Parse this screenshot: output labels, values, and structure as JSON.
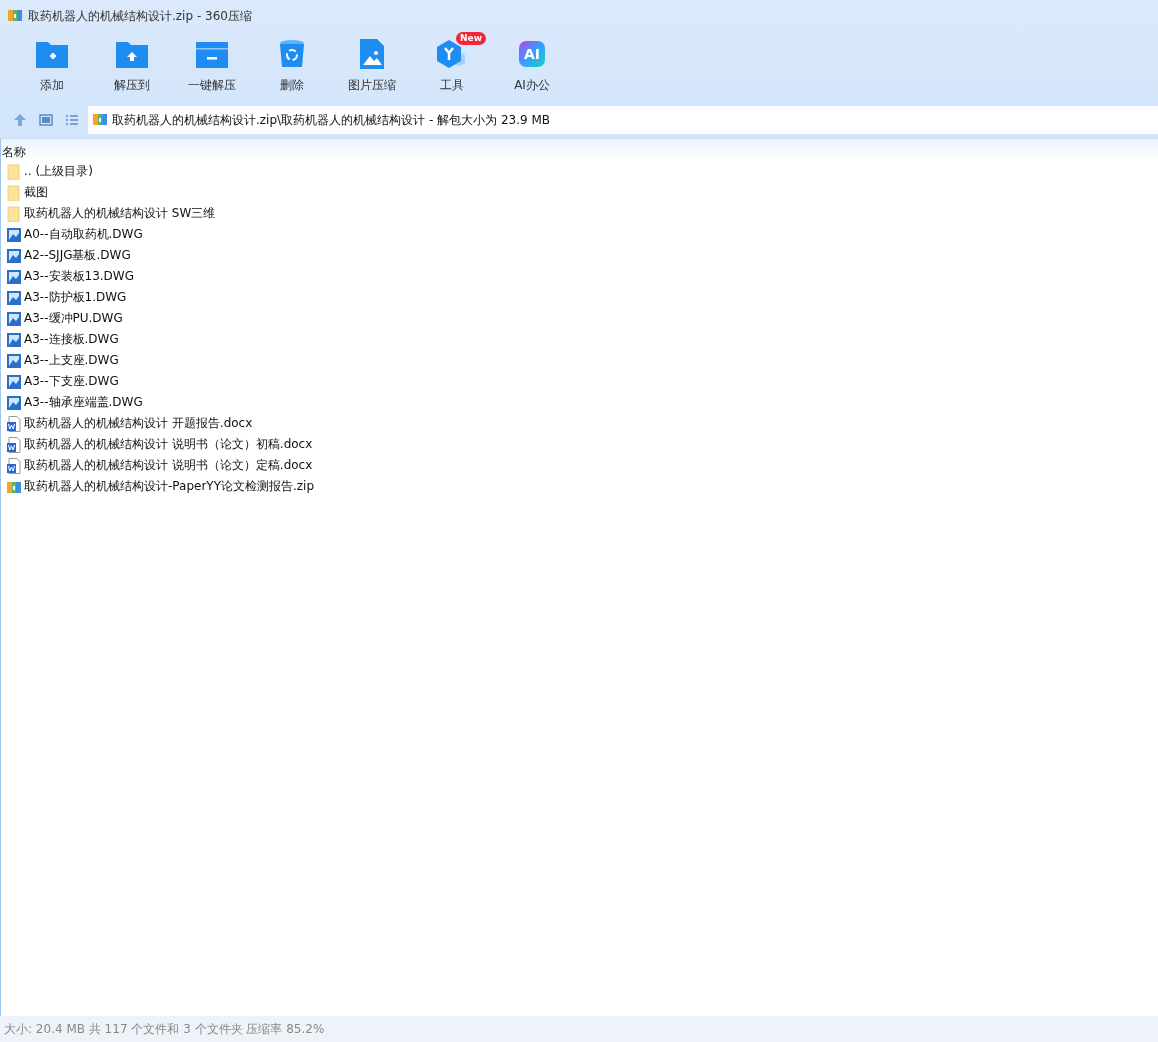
{
  "window": {
    "title": "取药机器人的机械结构设计.zip - 360压缩"
  },
  "toolbar": [
    {
      "kind": "add",
      "label": "添加"
    },
    {
      "kind": "extract",
      "label": "解压到"
    },
    {
      "kind": "quick",
      "label": "一键解压"
    },
    {
      "kind": "delete",
      "label": "删除"
    },
    {
      "kind": "image",
      "label": "图片压缩"
    },
    {
      "kind": "tools",
      "label": "工具",
      "badge": "New"
    },
    {
      "kind": "ai",
      "label": "AI办公",
      "icon_text": "AI"
    }
  ],
  "address": {
    "path": "取药机器人的机械结构设计.zip\\取药机器人的机械结构设计 - 解包大小为 23.9 MB"
  },
  "file_list": {
    "columns": [
      "名称"
    ],
    "rows": [
      {
        "kind": "folder",
        "name": ".. (上级目录)"
      },
      {
        "kind": "folder",
        "name": "截图"
      },
      {
        "kind": "folder",
        "name": "取药机器人的机械结构设计 SW三维"
      },
      {
        "kind": "dwg",
        "name": "A0--自动取药机.DWG"
      },
      {
        "kind": "dwg",
        "name": "A2--SJJG基板.DWG"
      },
      {
        "kind": "dwg",
        "name": "A3--安装板13.DWG"
      },
      {
        "kind": "dwg",
        "name": "A3--防护板1.DWG"
      },
      {
        "kind": "dwg",
        "name": "A3--缓冲PU.DWG"
      },
      {
        "kind": "dwg",
        "name": "A3--连接板.DWG"
      },
      {
        "kind": "dwg",
        "name": "A3--上支座.DWG"
      },
      {
        "kind": "dwg",
        "name": "A3--下支座.DWG"
      },
      {
        "kind": "dwg",
        "name": "A3--轴承座端盖.DWG"
      },
      {
        "kind": "docx",
        "name": "取药机器人的机械结构设计 开题报告.docx"
      },
      {
        "kind": "docx",
        "name": "取药机器人的机械结构设计 说明书（论文）初稿.docx"
      },
      {
        "kind": "docx",
        "name": "取药机器人的机械结构设计 说明书（论文）定稿.docx"
      },
      {
        "kind": "zip",
        "name": "取药机器人的机械结构设计-PaperYY论文检测报告.zip"
      }
    ]
  },
  "status_bar": "大小: 20.4 MB 共 117 个文件和 3 个文件夹 压缩率 85.2%"
}
